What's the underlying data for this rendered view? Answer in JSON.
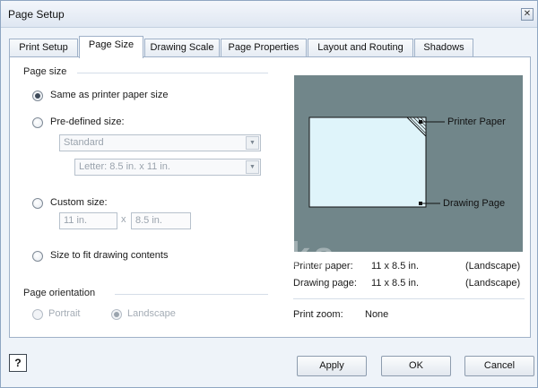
{
  "window": {
    "title": "Page Setup",
    "close_glyph": "✕"
  },
  "tabs": [
    {
      "label": "Print Setup",
      "active": false
    },
    {
      "label": "Page Size",
      "active": true
    },
    {
      "label": "Drawing Scale",
      "active": false
    },
    {
      "label": "Page Properties",
      "active": false
    },
    {
      "label": "Layout and Routing",
      "active": false
    },
    {
      "label": "Shadows",
      "active": false
    }
  ],
  "page_size": {
    "heading": "Page size",
    "options": {
      "same_as_printer": {
        "label": "Same as printer paper size",
        "checked": true
      },
      "predefined": {
        "label": "Pre-defined size:",
        "checked": false
      },
      "custom": {
        "label": "Custom size:",
        "checked": false
      },
      "fit": {
        "label": "Size to fit drawing contents",
        "checked": false
      }
    },
    "predefined_standard": "Standard",
    "predefined_letter": "Letter:  8.5 in. x 11 in.",
    "custom_width": "11 in.",
    "custom_times": "x",
    "custom_height": "8.5 in."
  },
  "orientation": {
    "heading": "Page orientation",
    "portrait": {
      "label": "Portrait",
      "checked": false
    },
    "landscape": {
      "label": "Landscape",
      "checked": true
    }
  },
  "preview": {
    "printer_paper_label": "Printer Paper",
    "drawing_page_label": "Drawing Page",
    "background_color": "#71868a",
    "sheet_color": "#dff4fa"
  },
  "info": {
    "printer_paper": {
      "key": "Printer paper:",
      "value": "11 x 8.5 in.",
      "orientation": "(Landscape)"
    },
    "drawing_page": {
      "key": "Drawing page:",
      "value": "11 x 8.5 in.",
      "orientation": "(Landscape)"
    },
    "print_zoom": {
      "key": "Print zoom:",
      "value": "None"
    }
  },
  "buttons": {
    "help_glyph": "?",
    "apply": "Apply",
    "ok": "OK",
    "cancel": "Cancel"
  },
  "watermark": "Dr         ks"
}
